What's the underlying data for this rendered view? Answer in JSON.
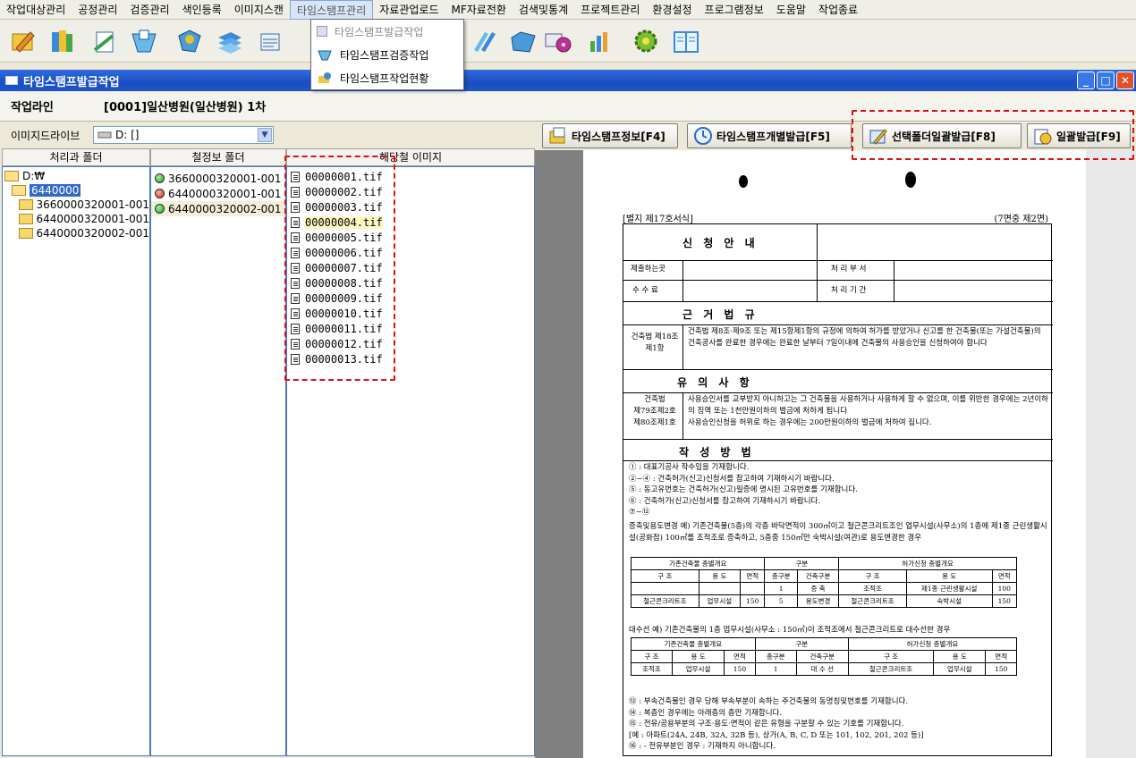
{
  "menu": [
    "작업대상관리",
    "공정관리",
    "검증관리",
    "색인등록",
    "이미지스캔",
    "타임스탬프관리",
    "자료관업로드",
    "MF자료전환",
    "검색및통계",
    "프로젝트관리",
    "환경설정",
    "프로그램정보",
    "도움말",
    "작업종료"
  ],
  "dropdown": {
    "items": [
      "타임스탬프발급작업",
      "타임스탬프검증작업",
      "타임스탬프작업현황"
    ]
  },
  "window": {
    "title": "타임스탬프발급작업"
  },
  "workline": {
    "label": "작업라인",
    "value": "[0001]일산병원(일산병원) 1차"
  },
  "drive": {
    "label": "이미지드라이브",
    "selected": "D: []"
  },
  "columns": {
    "folder": "처리과 폴더",
    "volume": "철정보 폴더",
    "images": "해당철 이미지"
  },
  "folder_tree": [
    {
      "label": "D:₩",
      "level": 0,
      "open": true
    },
    {
      "label": "6440000",
      "level": 1,
      "open": true,
      "selected": true
    },
    {
      "label": "3660000320001-001",
      "level": 2
    },
    {
      "label": "6440000320001-001",
      "level": 2
    },
    {
      "label": "6440000320002-001",
      "level": 2
    }
  ],
  "volume_list": [
    {
      "label": "3660000320001-001",
      "status": "green"
    },
    {
      "label": "6440000320001-001",
      "status": "red"
    },
    {
      "label": "6440000320002-001",
      "status": "green",
      "selected": true
    }
  ],
  "image_list": [
    "00000001.tif",
    "00000002.tif",
    "00000003.tif",
    "00000004.tif",
    "00000005.tif",
    "00000006.tif",
    "00000007.tif",
    "00000008.tif",
    "00000009.tif",
    "00000010.tif",
    "00000011.tif",
    "00000012.tif",
    "00000013.tif"
  ],
  "buttons": {
    "info": "타임스탬프정보[F4]",
    "individual": "타임스탬프개별발급[F5]",
    "selected_folder": "선택폴더일괄발급[F8]",
    "batch": "일괄발급[F9]"
  },
  "document": {
    "header_left": "[별지 제17호서식]",
    "header_right": "(7면중 제2면)",
    "sec1_title": "신 청 안 내",
    "r1_label": "제출하는곳",
    "r1_right": "처 리 부 서",
    "r2_label": "수 수 료",
    "r2_right": "처 리 기 간",
    "sec2_title": "근 거 법 규",
    "law_label": "건축법 제18조제1항",
    "law_text": "건축법 제8조·제9조 또는 제15항제1항의 규정에 의하여 허가를 받았거나 신고를 한 건축물(또는 가설건축물)의 건축공사를 완료한 경우에는 완료한 날부터 7일이내에 건축물의 사용승인을 신청하여야 합니다",
    "sec3_title": "유 의 사 항",
    "note_label1": "건축법",
    "note_label2": "제79조제2호",
    "note_label3": "제80조제1호",
    "note_text1": "사용승인서를 교부받지 아니하고는 그 건축물을 사용하거나 사용하게 할 수 없으며, 이를 위반한 경우에는 2년이하의 징역 또는 1천만원이하의 벌금에 처하게 됩니다",
    "note_text2": "사용승인신청을 허위로 하는 경우에는 200만원이하의 벌금에 처하여 집니다.",
    "sec4_title": "작 성 방 법",
    "method_lines": [
      "① : 대표기공사 작수임을 기재합니다.",
      "②~④ : 건축허가(신고)신청서를 참고하여 기재하시기 바랍니다.",
      "⑤ : 동고유번호는 건축허가(신고)필증에 명시된 고유번호를 기재합니다.",
      "⑥ : 건축허가(신고)신청서를 참고하여 기재하시기 바랍니다.",
      "⑦~⑫"
    ],
    "example1": "증축및용도변경 예) 기존건축물(5층)의 각층 바닥면적이 300㎡이고 철근콘크리트조인 업무시설(사무소)의 1층에 제1종 근린생활시설(공화점) 100㎡를 조적조로 증축하고, 5층중 150㎡만 숙박시설(여관)로 용도변경한 경우",
    "t1_headers": [
      "기존건축물 층별개요",
      "구분",
      "허가신청 층별개요"
    ],
    "t1_sub": [
      "구 조",
      "용 도",
      "면적",
      "층구분",
      "건축구분",
      "구 조",
      "용 도",
      "면적"
    ],
    "t1_row1": [
      "",
      "",
      "",
      "1",
      "증 축",
      "조적조",
      "제1종 근린생활시설",
      "100"
    ],
    "t1_row2": [
      "철근콘크리트조",
      "업무시설",
      "150",
      "5",
      "용도변경",
      "철근콘크리트조",
      "숙박시설",
      "150"
    ],
    "example2": "대수선 예) 기존건축물의 1층 업무시설(사무소 : 150㎡)이 조적조에서 철근콘크리트로 대수선한 경우",
    "t2_headers": [
      "기존건축물 층별개요",
      "구분",
      "허가신청 층별개요"
    ],
    "t2_sub": [
      "구 조",
      "용 도",
      "면적",
      "층구분",
      "건축구분",
      "구 조",
      "용 도",
      "면적"
    ],
    "t2_row1": [
      "조적조",
      "업무시설",
      "150",
      "1",
      "대 수 선",
      "철근콘크리트조",
      "업무시설",
      "150"
    ],
    "footer_lines": [
      "⑬ : 부속건축물인 경우 당해 부속부분이 속하는 주건축물의 동명칭및번호를 기재합니다.",
      "⑭ : 복층인 경우에는 아래층의 층만 기재합니다.",
      "⑮ : 전유/공용부분의 구조·용도·면적이 같은 유형을 구분할 수 있는 기호를 기재합니다.",
      "[예 : 아파트(24A, 24B, 32A, 32B 등), 상가(A, B, C, D 또는 101, 102, 201, 202 등)]",
      "⑯ : - 전유부분인 경우 : 기재하지 아니합니다."
    ]
  },
  "colors": {
    "titlebar": "#1a4fc4",
    "selection": "#316ac5",
    "highlight_dash": "#e01010"
  }
}
